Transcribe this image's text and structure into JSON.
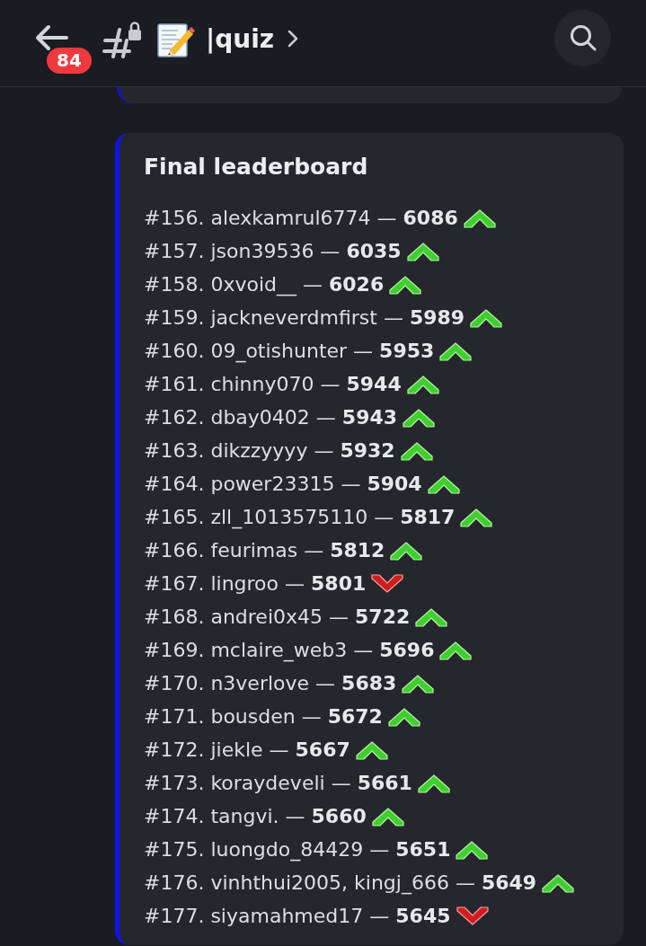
{
  "header": {
    "badge": "84",
    "channel_name": "|quiz"
  },
  "embed": {
    "title": "Final leaderboard",
    "entries": [
      {
        "text": "#156. alexkamrul6774 — **6086**",
        "kind": "up"
      },
      {
        "text": "#157. json39536 — **6035**",
        "kind": "up"
      },
      {
        "text": "#158. 0xvoid__ — **6026**",
        "kind": "up"
      },
      {
        "text": "#159. jackneverdmfirst — **5989**",
        "kind": "up"
      },
      {
        "text": "#160. 09_otishunter — **5953**",
        "kind": "up"
      },
      {
        "text": "#161. chinny070 — **5944**",
        "kind": "up"
      },
      {
        "text": "#162. dbay0402 — **5943**",
        "kind": "up"
      },
      {
        "text": "#163. dikzzyyyy — **5932**",
        "kind": "up"
      },
      {
        "text": "#164. power23315 — **5904**",
        "kind": "up"
      },
      {
        "text": "#165. zll_1013575110 — **5817**",
        "kind": "up"
      },
      {
        "text": "#166. feurimas — **5812**",
        "kind": "up"
      },
      {
        "text": "#167. lingroo — **5801**",
        "kind": "down"
      },
      {
        "text": "#168. andrei0x45 — **5722**",
        "kind": "up"
      },
      {
        "text": "#169. mclaire_web3 — **5696**",
        "kind": "up"
      },
      {
        "text": "#170. n3verlove — **5683**",
        "kind": "up"
      },
      {
        "text": "#171. bousden — **5672**",
        "kind": "up"
      },
      {
        "text": "#172. jiekle — **5667**",
        "kind": "up"
      },
      {
        "text": "#173. koraydeveli — **5661**",
        "kind": "up"
      },
      {
        "text": "#174. tangvi. — **5660**",
        "kind": "up"
      },
      {
        "text": "#175. luongdo_84429 — **5651**",
        "kind": "up"
      },
      {
        "text": "#176. vinhthui2005, kingj_666 — **5649**",
        "kind": "up"
      },
      {
        "text": "#177. siyamahmed17 — **5645**",
        "kind": "down"
      }
    ]
  }
}
